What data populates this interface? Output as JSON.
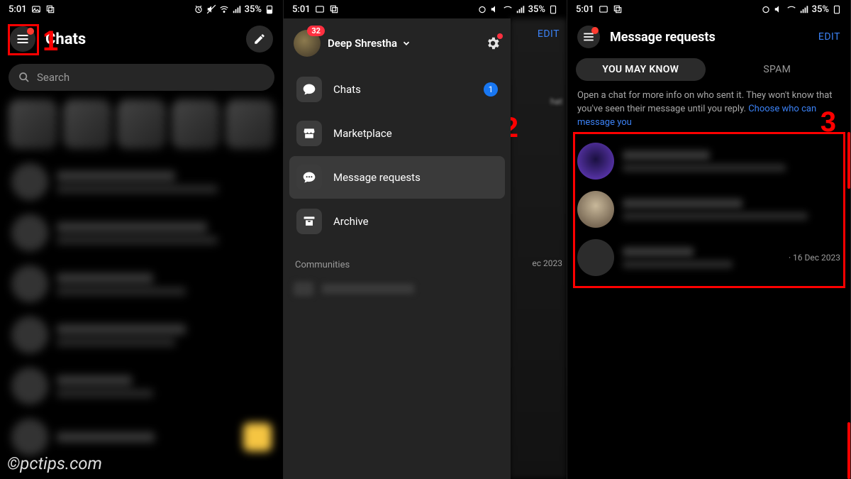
{
  "status": {
    "time": "5:01",
    "battery": "35%"
  },
  "panel1": {
    "title": "Chats",
    "search_placeholder": "Search",
    "annotation_number": "1"
  },
  "panel2": {
    "profile_name": "Deep Shrestha",
    "profile_badge": "32",
    "edit": "EDIT",
    "menu": {
      "chats": "Chats",
      "chats_badge": "1",
      "marketplace": "Marketplace",
      "message_requests": "Message requests",
      "archive": "Archive"
    },
    "communities_header": "Communities",
    "date_peek": "ec 2023",
    "hat_peek": "hat",
    "annotation_number": "2"
  },
  "panel3": {
    "title": "Message requests",
    "edit": "EDIT",
    "tab_known": "YOU MAY KNOW",
    "tab_spam": "SPAM",
    "info_a": "Open a chat for more info on who sent it. They won't know that you've seen their message until you reply. ",
    "info_link": "Choose who can message you",
    "requests": [
      {
        "date": ""
      },
      {
        "date": ""
      },
      {
        "date": "· 16 Dec 2023"
      }
    ],
    "annotation_number": "3"
  },
  "watermark": "©pctips.com"
}
